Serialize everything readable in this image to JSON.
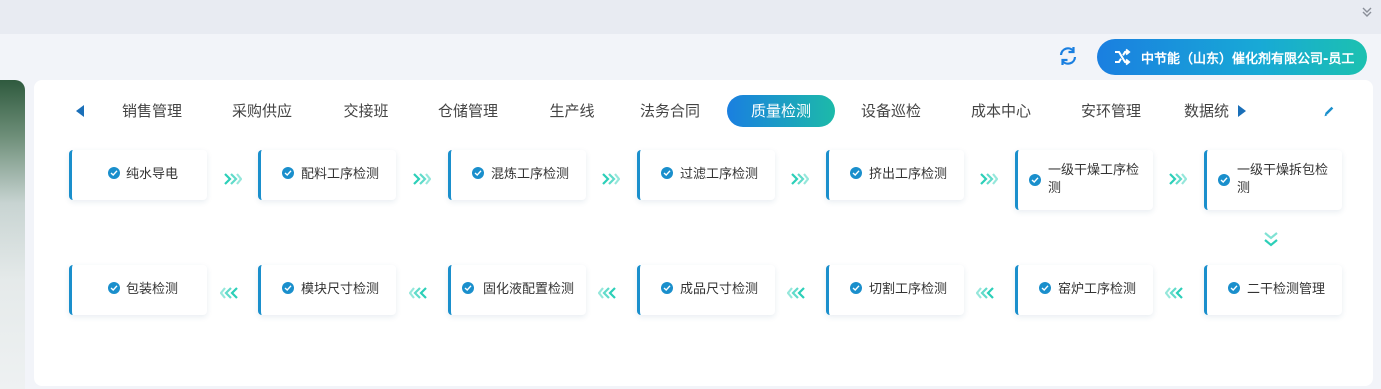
{
  "topbar": {
    "collapse_icon": "chevrons-down-icon"
  },
  "header": {
    "refresh_icon": "refresh-icon",
    "company_icon": "shuffle-icon",
    "company_label": "中节能（山东）催化剂有限公司-员工"
  },
  "tabs": {
    "items": [
      {
        "label": "销售管理"
      },
      {
        "label": "采购供应"
      },
      {
        "label": "交接班"
      },
      {
        "label": "仓储管理"
      },
      {
        "label": "生产线"
      },
      {
        "label": "法务合同"
      },
      {
        "label": "质量检测",
        "active": true
      },
      {
        "label": "设备巡检"
      },
      {
        "label": "成本中心"
      },
      {
        "label": "安环管理"
      },
      {
        "label": "数据统"
      }
    ],
    "edit_icon": "pencil-icon"
  },
  "flow": {
    "row1": [
      {
        "label": "纯水导电"
      },
      {
        "label": "配料工序检测"
      },
      {
        "label": "混炼工序检测"
      },
      {
        "label": "过滤工序检测"
      },
      {
        "label": "挤出工序检测"
      },
      {
        "label": "一级干燥工序检测"
      },
      {
        "label": "一级干燥拆包检测"
      }
    ],
    "row2": [
      {
        "label": "包装检测"
      },
      {
        "label": "模块尺寸检测"
      },
      {
        "label": "固化液配置检测"
      },
      {
        "label": "成品尺寸检测"
      },
      {
        "label": "切割工序检测"
      },
      {
        "label": "窑炉工序检测"
      },
      {
        "label": "二干检测管理"
      }
    ]
  },
  "colors": {
    "accent_blue": "#1a8fcc",
    "arrow_teal": "#2ccfb8",
    "gradient_start": "#1a7fe0",
    "gradient_end": "#1cc1b0"
  }
}
